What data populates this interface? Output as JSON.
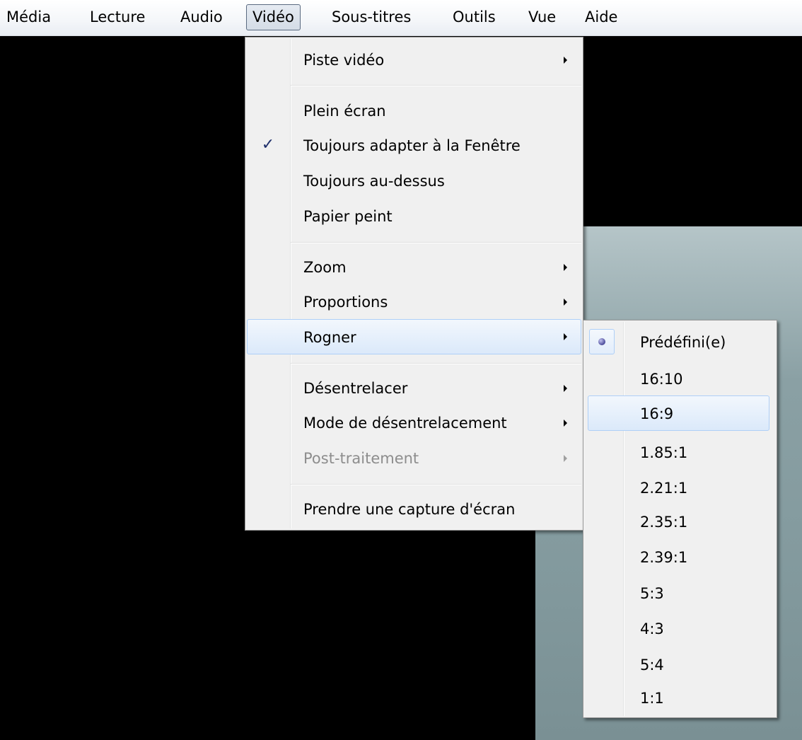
{
  "menubar": {
    "items": [
      "Média",
      "Lecture",
      "Audio",
      "Vidéo",
      "Sous-titres",
      "Outils",
      "Vue",
      "Aide"
    ]
  },
  "video_menu": {
    "items": [
      {
        "label": "Piste vidéo",
        "submenu": true
      },
      {
        "label": "Plein écran"
      },
      {
        "label": "Toujours adapter à la Fenêtre",
        "checked": true
      },
      {
        "label": "Toujours au-dessus"
      },
      {
        "label": "Papier peint"
      },
      {
        "label": "Zoom",
        "submenu": true
      },
      {
        "label": "Proportions",
        "submenu": true
      },
      {
        "label": "Rogner",
        "submenu": true,
        "highlighted": true
      },
      {
        "label": "Désentrelacer",
        "submenu": true
      },
      {
        "label": "Mode de désentrelacement",
        "submenu": true
      },
      {
        "label": "Post-traitement",
        "submenu": true,
        "disabled": true
      },
      {
        "label": "Prendre une capture d'écran"
      }
    ],
    "check_glyph": "✓"
  },
  "crop_menu": {
    "items": [
      {
        "label": "Prédéfini(e)",
        "selected": true
      },
      {
        "label": "16:10"
      },
      {
        "label": "16:9",
        "highlighted": true
      },
      {
        "label": "1.85:1"
      },
      {
        "label": "2.21:1"
      },
      {
        "label": "2.35:1"
      },
      {
        "label": "2.39:1"
      },
      {
        "label": "5:3"
      },
      {
        "label": "4:3"
      },
      {
        "label": "5:4"
      },
      {
        "label": "1:1"
      }
    ]
  },
  "colors": {
    "highlight_border": "#aecff7",
    "video_background": "#000000",
    "menu_background": "#f0f0f0"
  }
}
